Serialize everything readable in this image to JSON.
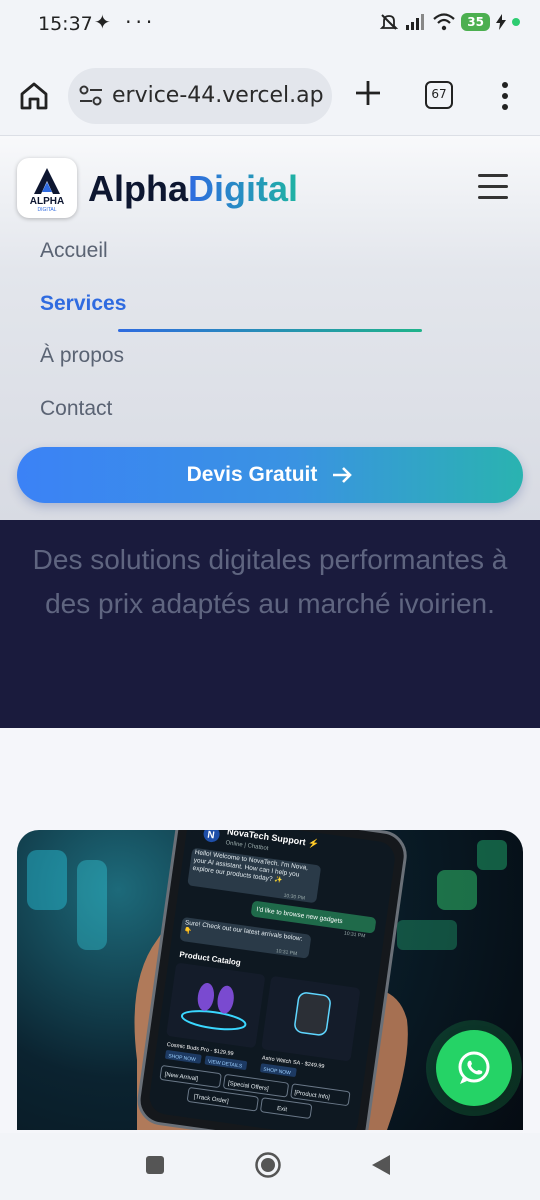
{
  "status_bar": {
    "time": "15:37",
    "left_icons": "✦ ···",
    "battery": "35"
  },
  "browser": {
    "url": "ervice-44.vercel.app",
    "tab_count": "67"
  },
  "site": {
    "brand_part1": "Alpha",
    "brand_part2": "Digital",
    "logo_text": "ALPHA",
    "logo_subtext": "DIGITAL"
  },
  "nav": {
    "items": [
      {
        "label": "Accueil",
        "active": false
      },
      {
        "label": "Services",
        "active": true
      },
      {
        "label": "À propos",
        "active": false
      },
      {
        "label": "Contact",
        "active": false
      }
    ]
  },
  "cta": {
    "label": "Devis Gratuit"
  },
  "hero": {
    "subtitle": "Des solutions digitales performantes à des prix adaptés au marché ivoirien."
  },
  "phone_chat": {
    "header": "NovaTech Support ⚡",
    "status": "Online | Chatbot",
    "bot_msg_1": "Hello! Welcome to NovaTech. I'm Nova, your AI assistant. How can I help you explore our products today? ✨",
    "time_1": "10:30 PM",
    "user_msg": "I'd like to browse new gadgets",
    "time_2": "10:31 PM",
    "bot_msg_2": "Sure! Check out our latest arrivals below: 👇",
    "time_3": "10:31 PM",
    "catalog_title": "Product Catalog",
    "product_1": "Cosmic Buds Pro - $129.99",
    "product_2": "Astro Watch SA - $249.99",
    "shop_now": "SHOP NOW",
    "view_details": "VIEW DETAILS",
    "btn_new_arrivals": "[New Arrival]",
    "btn_special_offers": "[Special Offers]",
    "btn_product_info": "[Product Info]",
    "btn_track_order": "[Track Order]",
    "btn_exit": "Exit"
  },
  "colors": {
    "accent_blue": "#2f6be0",
    "accent_teal": "#1fb3a3",
    "hero_bg": "#1a1b3d",
    "whatsapp": "#25d366"
  }
}
